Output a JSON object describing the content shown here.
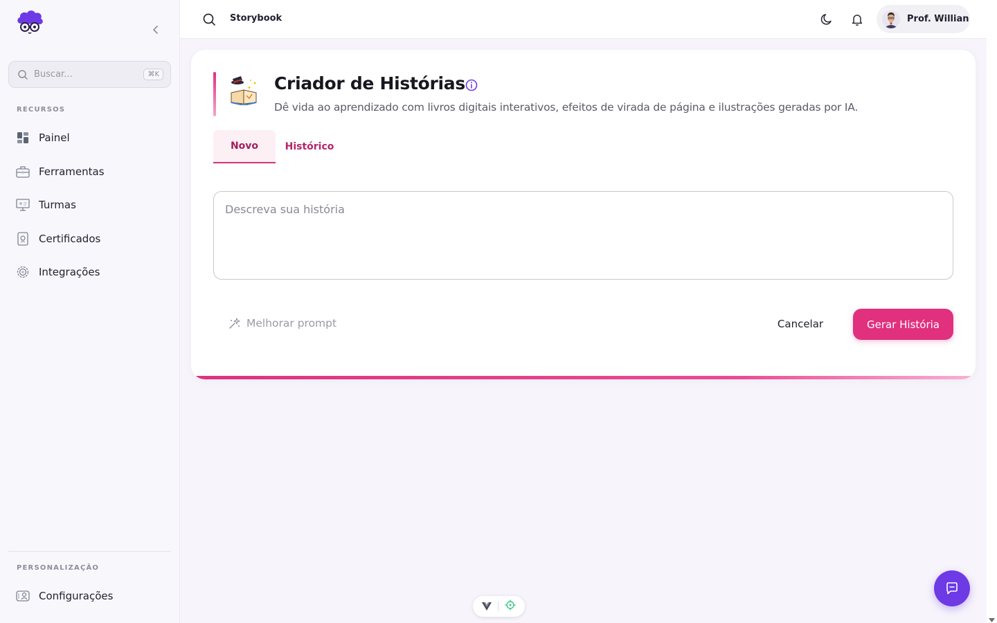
{
  "sidebar": {
    "search": {
      "placeholder": "Buscar...",
      "shortcut": "⌘K"
    },
    "sections": {
      "resources_label": "RECURSOS",
      "personalization_label": "PERSONALIZAÇÃO"
    },
    "items": [
      {
        "label": "Painel",
        "icon": "dashboard-icon"
      },
      {
        "label": "Ferramentas",
        "icon": "toolbox-icon"
      },
      {
        "label": "Turmas",
        "icon": "classroom-icon"
      },
      {
        "label": "Certificados",
        "icon": "certificate-icon"
      },
      {
        "label": "Integrações",
        "icon": "gear-icon"
      }
    ],
    "settings": {
      "label": "Configurações",
      "icon": "settings-icon"
    }
  },
  "topbar": {
    "title": "Storybook",
    "user": {
      "name": "Prof. Willian"
    }
  },
  "card": {
    "title": "Criador de Histórias",
    "subtitle": "Dê vida ao aprendizado com livros digitais interativos, efeitos de virada de página e ilustrações geradas por IA.",
    "tabs": [
      {
        "label": "Novo",
        "active": true
      },
      {
        "label": "Histórico",
        "active": false
      }
    ],
    "textarea": {
      "placeholder": "Descreva sua história",
      "value": ""
    },
    "improve_label": "Melhorar prompt",
    "cancel_label": "Cancelar",
    "generate_label": "Gerar História"
  },
  "colors": {
    "accent": "#e0307e",
    "chat_button": "#6d3ae6",
    "tab_text": "#b52467"
  }
}
